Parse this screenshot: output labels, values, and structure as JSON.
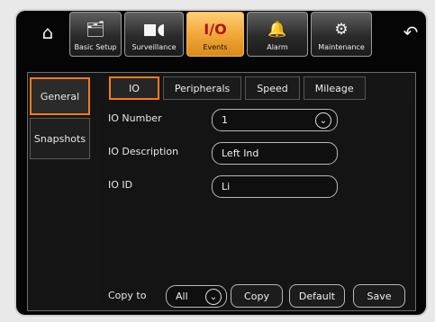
{
  "nav": {
    "items": [
      {
        "label": "Basic Setup",
        "icon": "sd-card-icon"
      },
      {
        "label": "Surveillance",
        "icon": "camera-icon"
      },
      {
        "label": "Events",
        "icon_text": "I/O"
      },
      {
        "label": "Alarm",
        "icon": "bell-icon"
      },
      {
        "label": "Maintenance",
        "icon": "wrench-gear-icon"
      }
    ],
    "active": "Events",
    "home_icon": "home-icon",
    "back_icon": "back-arrow-icon"
  },
  "side_tabs": [
    {
      "label": "General"
    },
    {
      "label": "Snapshots"
    }
  ],
  "sub_tabs": [
    "IO",
    "Peripherals",
    "Speed",
    "Mileage"
  ],
  "form": {
    "io_number": {
      "label": "IO Number",
      "value": "1"
    },
    "io_description": {
      "label": "IO Description",
      "value": "Left Ind"
    },
    "io_id": {
      "label": "IO ID",
      "value": "Li"
    }
  },
  "footer": {
    "copy_to_label": "Copy to",
    "copy_to_value": "All",
    "copy_button": "Copy",
    "default_button": "Default",
    "save_button": "Save"
  },
  "colors": {
    "accent": "#ff7a18",
    "active_nav": "#f0a536",
    "background": "#050505"
  }
}
